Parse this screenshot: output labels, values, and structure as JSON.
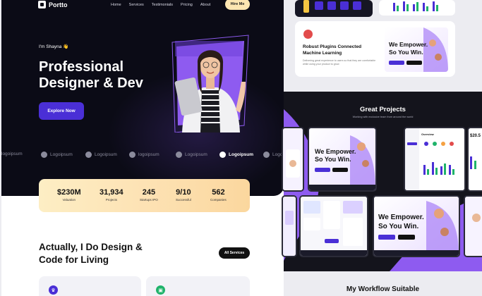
{
  "nav": {
    "brand": "Portto",
    "links": [
      "Home",
      "Services",
      "Testimonials",
      "Pricing",
      "About"
    ],
    "cta": "Hire Me"
  },
  "hero": {
    "greeting": "I'm Shayna 👋",
    "headline": "Professional Designer & Dev",
    "cta": "Explore Now"
  },
  "logos": [
    "logoipsum",
    "Logoipsum",
    "Logoipsum",
    "logoipsum",
    "Logoipsum",
    "Logoipsum",
    "Logoi"
  ],
  "stats": [
    {
      "value": "$230M",
      "label": "Valuation"
    },
    {
      "value": "31,934",
      "label": "Projects"
    },
    {
      "value": "245",
      "label": "Startups IPO"
    },
    {
      "value": "9/10",
      "label": "Successful"
    },
    {
      "value": "562",
      "label": "Companies"
    }
  ],
  "services": {
    "title": "Actually, I Do Design & Code for Living",
    "button": "All Services"
  },
  "plugin": {
    "title": "Robust Plugins Connected Machine Learning",
    "desc": "Delivering great experience to users so that they are comfortable while using your product to grow",
    "shot_headline": "We Empower. So You Win."
  },
  "projects": {
    "title": "Great Projects",
    "subtitle": "Working with exclusive team from around the world",
    "shot_headline": "We Empower. So You Win.",
    "dash_title": "Overview",
    "dash_value": "$20.5"
  },
  "workflow": {
    "title": "My Workflow Suitable"
  },
  "colors": {
    "hero_bg": "#0b0b16",
    "accent": "#4a2fd6",
    "hire": "#fde6b2",
    "stats_gradient_start": "#fdeec4",
    "stats_gradient_end": "#fbd79e",
    "purple": "#8e5bf0"
  }
}
